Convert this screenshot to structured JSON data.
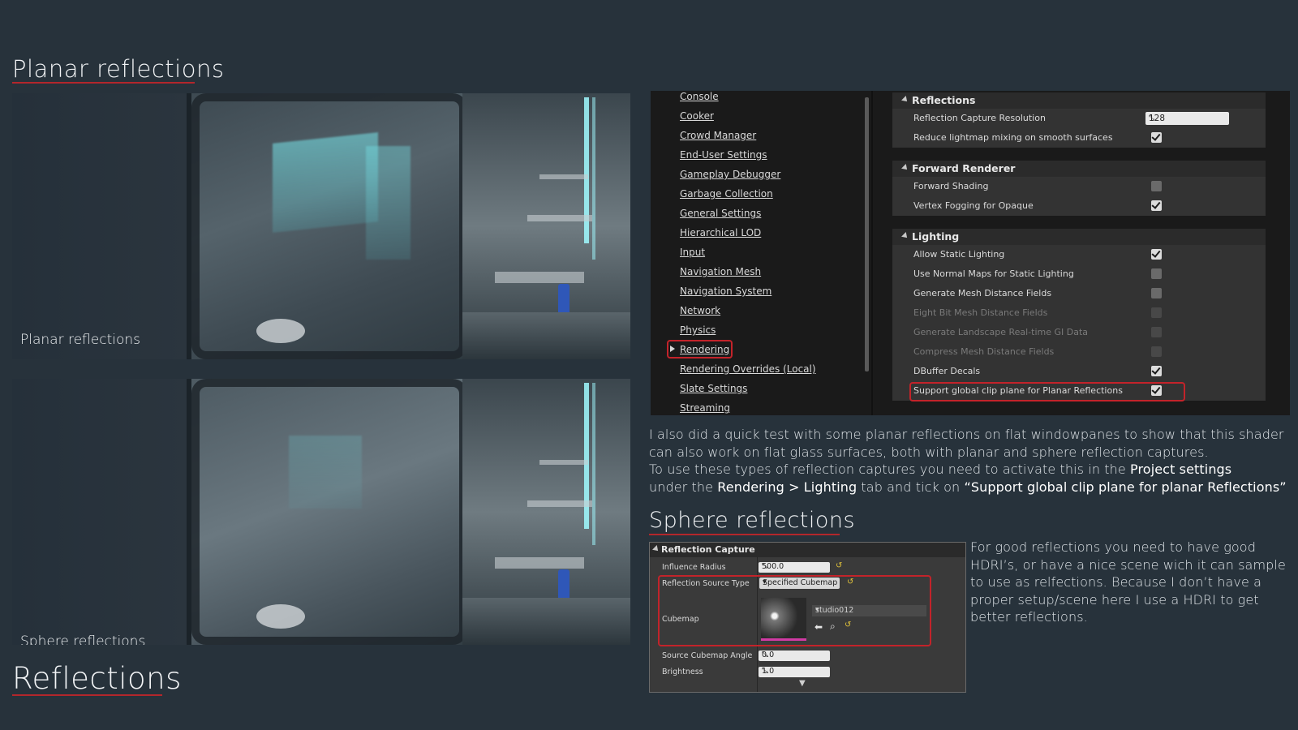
{
  "headings": {
    "planar": "Planar reflections",
    "sphere": "Sphere reflections",
    "reflections": "Reflections"
  },
  "renders": {
    "top_caption": "Planar reflections",
    "bottom_caption": "Sphere reflections"
  },
  "nav": {
    "items": [
      "Console",
      "Cooker",
      "Crowd Manager",
      "End-User Settings",
      "Gameplay Debugger",
      "Garbage Collection",
      "General Settings",
      "Hierarchical LOD",
      "Input",
      "Navigation Mesh",
      "Navigation System",
      "Network",
      "Physics",
      "Rendering",
      "Rendering Overrides (Local)",
      "Slate Settings",
      "Streaming"
    ],
    "selected": "Rendering"
  },
  "settings": {
    "reflections": {
      "title": "Reflections",
      "resolution_label": "Reflection Capture Resolution",
      "resolution_value": "128",
      "reduce_lightmap_label": "Reduce lightmap mixing on smooth surfaces"
    },
    "forward_renderer": {
      "title": "Forward Renderer",
      "forward_shading_label": "Forward Shading",
      "vertex_fogging_label": "Vertex Fogging for Opaque"
    },
    "lighting": {
      "title": "Lighting",
      "rows": [
        {
          "label": "Allow Static Lighting",
          "checked": true,
          "enabled": true
        },
        {
          "label": "Use Normal Maps for Static Lighting",
          "checked": false,
          "enabled": true
        },
        {
          "label": "Generate Mesh Distance Fields",
          "checked": false,
          "enabled": true
        },
        {
          "label": "Eight Bit Mesh Distance Fields",
          "checked": false,
          "enabled": false
        },
        {
          "label": "Generate Landscape Real-time GI Data",
          "checked": false,
          "enabled": false
        },
        {
          "label": "Compress Mesh Distance Fields",
          "checked": false,
          "enabled": false
        },
        {
          "label": "DBuffer Decals",
          "checked": true,
          "enabled": true
        },
        {
          "label": "Support global clip plane for Planar Reflections",
          "checked": true,
          "enabled": true
        }
      ]
    }
  },
  "body": {
    "line1": "I also did a quick test with some planar reflections on flat windowpanes to show that this shader",
    "line2": "can also work on flat glass surfaces, both with planar and sphere reflection captures.",
    "line3_a": "To use these types of reflection captures you need to activate this in the ",
    "line3_b": "Project settings",
    "line4_a": "under the ",
    "line4_b": "Rendering > Lighting",
    "line4_c": " tab and tick on ",
    "line4_d": "“Support global clip plane for planar Reflections”"
  },
  "capture": {
    "title": "Reflection Capture",
    "influence_radius_label": "Influence Radius",
    "influence_radius_value": "500.0",
    "source_type_label": "Reflection Source Type",
    "source_type_value": "Specified Cubemap",
    "cubemap_label": "Cubemap",
    "cubemap_value": "studio012",
    "cubemap_angle_label": "Source Cubemap Angle",
    "cubemap_angle_value": "0.0",
    "brightness_label": "Brightness",
    "brightness_value": "1.0"
  },
  "side_text": {
    "line1": "For good reflections you need to have good",
    "line2": "HDRI’s, or have a nice scene wich it can sample",
    "line3": "to use as relfections. Because I don’t have a",
    "line4": "proper setup/scene here I use a HDRI to get",
    "line5": "better reflections."
  }
}
